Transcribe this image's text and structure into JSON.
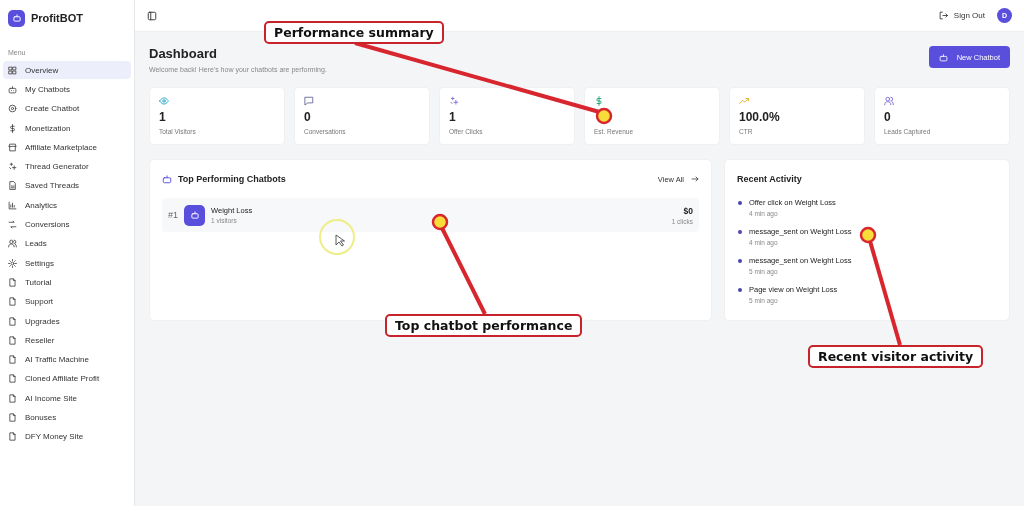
{
  "brand": "ProfitBOT",
  "sidebar": {
    "heading": "Menu",
    "items": [
      {
        "label": "Overview",
        "selected": true
      },
      {
        "label": "My Chatbots",
        "selected": false
      },
      {
        "label": "Create Chatbot",
        "selected": false
      },
      {
        "label": "Monetization",
        "selected": false
      },
      {
        "label": "Affiliate Marketplace",
        "selected": false
      },
      {
        "label": "Thread Generator",
        "selected": false
      },
      {
        "label": "Saved Threads",
        "selected": false
      },
      {
        "label": "Analytics",
        "selected": false
      },
      {
        "label": "Conversions",
        "selected": false
      },
      {
        "label": "Leads",
        "selected": false
      },
      {
        "label": "Settings",
        "selected": false
      },
      {
        "label": "Tutorial",
        "selected": false
      },
      {
        "label": "Support",
        "selected": false
      },
      {
        "label": "Upgrades",
        "selected": false
      },
      {
        "label": "Reseller",
        "selected": false
      },
      {
        "label": "AI Traffic Machine",
        "selected": false
      },
      {
        "label": "Cloned Affiliate Profit",
        "selected": false
      },
      {
        "label": "AI Income Site",
        "selected": false
      },
      {
        "label": "Bonuses",
        "selected": false
      },
      {
        "label": "DFY Money Site",
        "selected": false
      }
    ]
  },
  "topbar": {
    "sign_out": "Sign Out",
    "avatar": "D"
  },
  "header": {
    "title": "Dashboard",
    "subtitle": "Welcome back! Here's how your chatbots are performing.",
    "button": "New Chatbot"
  },
  "stats": [
    {
      "value": "1",
      "label": "Total Visitors"
    },
    {
      "value": "0",
      "label": "Conversations"
    },
    {
      "value": "1",
      "label": "Offer Clicks"
    },
    {
      "label": "Est. Revenue"
    },
    {
      "value": "100.0%",
      "label": "CTR"
    },
    {
      "value": "0",
      "label": "Leads Captured"
    }
  ],
  "top_chatbots": {
    "title": "Top Performing Chatbots",
    "view_all": "View All",
    "rows": [
      {
        "rank": "#1",
        "name": "Weight Loss",
        "visitors": "1 visitors",
        "revenue": "$0",
        "clicks": "1 clicks"
      }
    ]
  },
  "recent_activity": {
    "title": "Recent Activity",
    "items": [
      {
        "text": "Offer click on Weight Loss",
        "time": "4 min ago"
      },
      {
        "text": "message_sent on Weight Loss",
        "time": "4 min ago"
      },
      {
        "text": "message_sent on Weight Loss",
        "time": "5 min ago"
      },
      {
        "text": "Page view on Weight Loss",
        "time": "5 min ago"
      }
    ]
  },
  "callouts": [
    {
      "text": "Performance summary"
    },
    {
      "text": "Top chatbot performance"
    },
    {
      "text": "Recent visitor activity"
    }
  ]
}
